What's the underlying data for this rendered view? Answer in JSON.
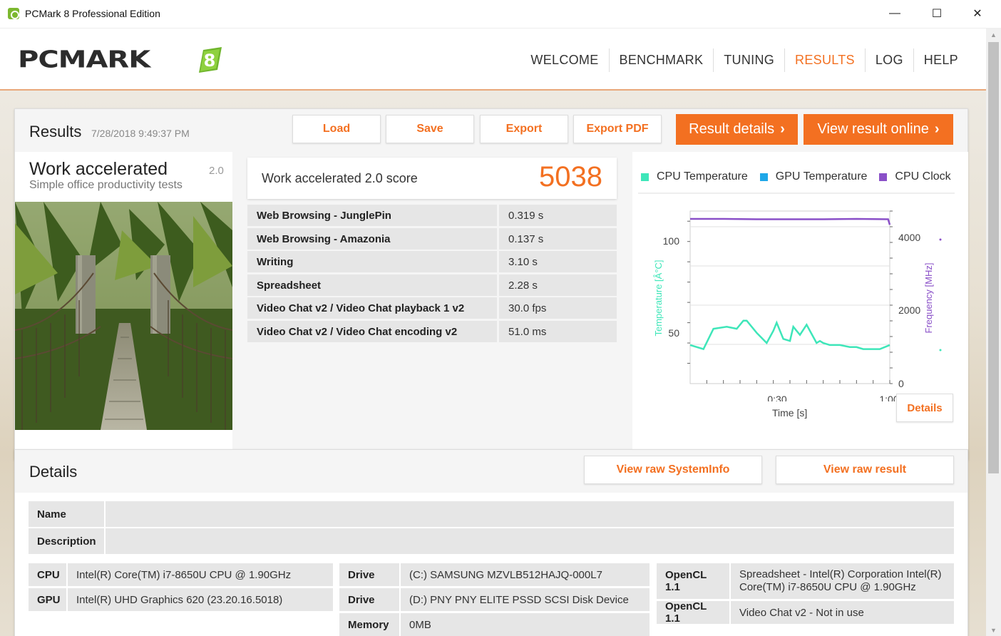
{
  "window": {
    "title": "PCMark 8 Professional Edition",
    "minimize": "—",
    "maximize": "☐",
    "close": "✕"
  },
  "logo": {
    "wordmark": "PCMARK",
    "digit": "8"
  },
  "nav": {
    "items": [
      {
        "label": "WELCOME"
      },
      {
        "label": "BENCHMARK"
      },
      {
        "label": "TUNING"
      },
      {
        "label": "RESULTS",
        "active": true
      },
      {
        "label": "LOG"
      },
      {
        "label": "HELP"
      }
    ]
  },
  "results": {
    "title": "Results",
    "timestamp": "7/28/2018 9:49:37 PM",
    "buttons": {
      "load": "Load",
      "save": "Save",
      "export": "Export",
      "export_pdf": "Export PDF",
      "result_details": "Result details",
      "view_online": "View result online"
    },
    "benchmark": {
      "name": "Work accelerated",
      "version": "2.0",
      "description": "Simple office productivity tests"
    },
    "score": {
      "label": "Work accelerated 2.0 score",
      "value": "5038"
    },
    "subtests": [
      {
        "name": "Web Browsing - JunglePin",
        "value": "0.319 s"
      },
      {
        "name": "Web Browsing - Amazonia",
        "value": "0.137 s"
      },
      {
        "name": "Writing",
        "value": "3.10 s"
      },
      {
        "name": "Spreadsheet",
        "value": "2.28 s"
      },
      {
        "name": "Video Chat v2 / Video Chat playback 1 v2",
        "value": "30.0 fps"
      },
      {
        "name": "Video Chat v2 / Video Chat encoding v2",
        "value": "51.0 ms"
      }
    ],
    "chart": {
      "legend": [
        {
          "label": "CPU Temperature",
          "color": "#3ee6b9"
        },
        {
          "label": "GPU Temperature",
          "color": "#1ea7e8"
        },
        {
          "label": "CPU Clock",
          "color": "#8a50c8"
        }
      ],
      "left_axis_label": "Temperature [Â°C]",
      "right_axis_label": "Frequency [MHz]",
      "x_axis_label": "Time [s]",
      "left_ticks": [
        "100",
        "50"
      ],
      "right_ticks": [
        "4000",
        "2000",
        "0"
      ],
      "x_ticks": [
        "0:30",
        "1:00"
      ],
      "details_button": "Details"
    }
  },
  "chart_data": {
    "type": "line",
    "xlabel": "Time [s]",
    "ylabel": "Temperature [Â°C]",
    "y2label": "Frequency [MHz]",
    "xlim": [
      0,
      60
    ],
    "ylim": [
      30,
      115
    ],
    "y2lim": [
      0,
      4400
    ],
    "series": [
      {
        "name": "CPU Temperature",
        "axis": "left",
        "color": "#3ee6b9",
        "x": [
          0,
          4,
          7,
          11,
          14,
          16,
          17,
          20,
          23,
          25,
          26,
          28,
          30,
          31,
          33,
          35,
          36,
          38,
          39,
          40,
          42,
          45,
          48,
          49,
          50,
          52,
          55,
          57,
          60
        ],
        "y": [
          49,
          47,
          57,
          58,
          57,
          61,
          61,
          55,
          50,
          56,
          60,
          52,
          51,
          58,
          54,
          59,
          56,
          50,
          51,
          50,
          49,
          49,
          48,
          48,
          48,
          47,
          47,
          47,
          49
        ]
      },
      {
        "name": "CPU Clock",
        "axis": "right",
        "color": "#8a50c8",
        "x": [
          0,
          10,
          20,
          30,
          40,
          50,
          59.5,
          60
        ],
        "y": [
          4200,
          4200,
          4190,
          4190,
          4190,
          4200,
          4190,
          4050
        ]
      }
    ]
  },
  "details": {
    "title": "Details",
    "buttons": {
      "raw_sysinfo": "View raw SystemInfo",
      "raw_result": "View raw result"
    },
    "name_label": "Name",
    "name_value": "",
    "description_label": "Description",
    "description_value": "",
    "cpu_label": "CPU",
    "cpu_value": "Intel(R) Core(TM) i7-8650U CPU @ 1.90GHz",
    "gpu_label": "GPU",
    "gpu_value": "Intel(R) UHD Graphics 620 (23.20.16.5018)",
    "drive1_label": "Drive",
    "drive1_value": "(C:) SAMSUNG MZVLB512HAJQ-000L7",
    "drive2_label": "Drive",
    "drive2_value": "(D:) PNY PNY ELITE PSSD SCSI Disk Device",
    "memory_label": "Memory",
    "memory_value": "0MB",
    "opencl1_label": "OpenCL 1.1",
    "opencl1_value": "Spreadsheet - Intel(R) Corporation Intel(R) Core(TM) i7-8650U CPU @ 1.90GHz",
    "opencl2_label": "OpenCL 1.1",
    "opencl2_value": "Video Chat v2 - Not in use"
  }
}
